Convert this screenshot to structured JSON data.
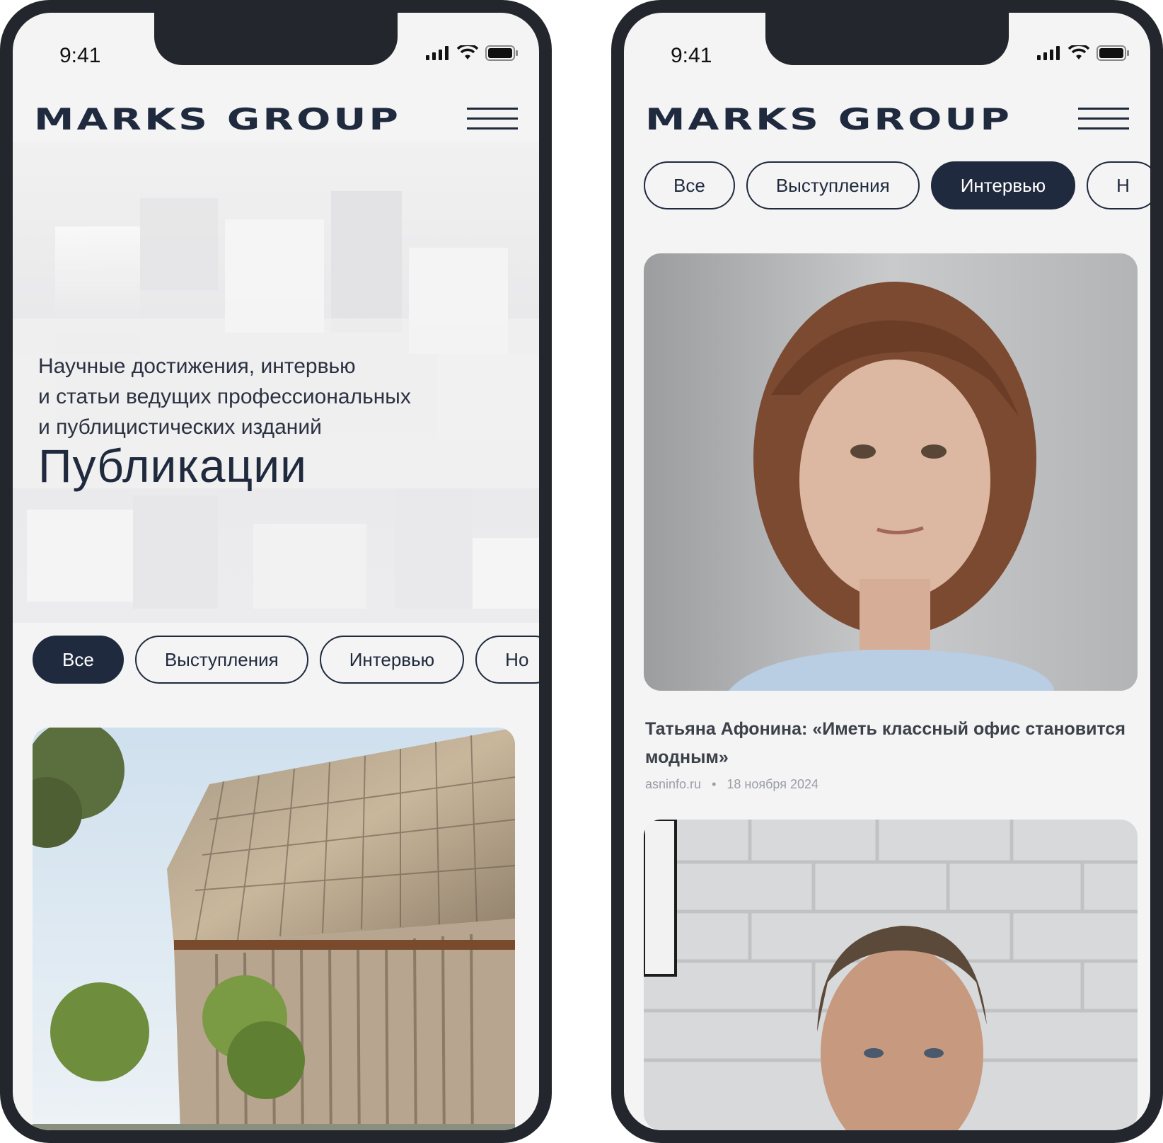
{
  "status_bar": {
    "time": "9:41"
  },
  "brand": {
    "logo_text": "MARKS GROUP"
  },
  "left_screen": {
    "hero": {
      "subtitle_lines": [
        "Научные достижения, интервью",
        "и статьи ведущих профессиональных",
        "и публицистических изданий"
      ],
      "title": "Публикации"
    },
    "filters": [
      {
        "label": "Все",
        "active": true
      },
      {
        "label": "Выступления",
        "active": false
      },
      {
        "label": "Интервью",
        "active": false
      },
      {
        "label": "Но",
        "active": false
      }
    ]
  },
  "right_screen": {
    "filters": [
      {
        "label": "Все",
        "active": false
      },
      {
        "label": "Выступления",
        "active": false
      },
      {
        "label": "Интервью",
        "active": true
      },
      {
        "label": "Н",
        "active": false
      }
    ],
    "article": {
      "title": "Татьяна Афонина: «Иметь классный офис становится модным»",
      "source": "asninfo.ru",
      "separator": "•",
      "date": "18 ноября 2024"
    }
  },
  "colors": {
    "accent": "#1f2a3e",
    "frame": "#23262d",
    "background": "#f4f4f4",
    "meta": "#9a9ea6"
  },
  "icons": [
    "signal-icon",
    "wifi-icon",
    "battery-icon",
    "hamburger-menu-icon"
  ]
}
